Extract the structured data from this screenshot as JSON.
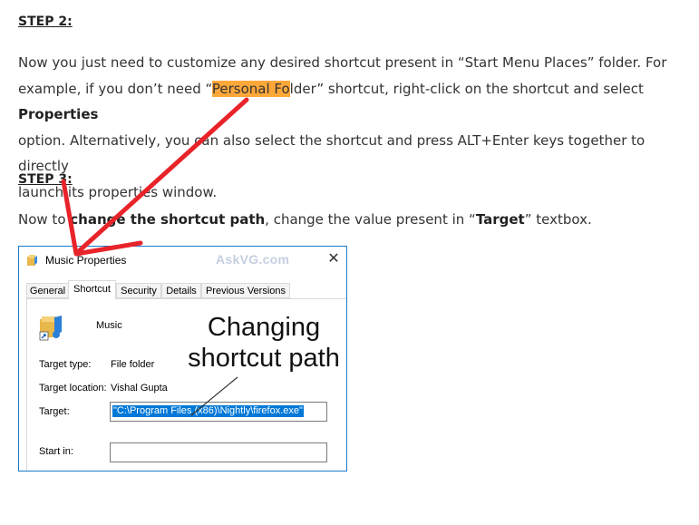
{
  "step2": {
    "heading": "STEP 2:",
    "line1": "Now you just need to customize any desired shortcut present in “Start Menu Places” folder. For",
    "line2_pre": "example, if you don’t need “",
    "line2_highlight": "Personal Fo",
    "line2_post": "lder” shortcut, right-click on the shortcut and select ",
    "line2_bold": "Properties",
    "line3": "option. Alternatively, you can also select the shortcut and press ALT+Enter keys together to directly",
    "line4": "launch its properties window."
  },
  "step3": {
    "heading": "STEP 3:",
    "line_pre": "Now to ",
    "line_bold1": "change the shortcut path",
    "line_mid": ", change the value present in “",
    "line_bold2": "Target",
    "line_post": "” textbox."
  },
  "dialog": {
    "title": "Music Properties",
    "watermark": "AskVG.com",
    "close": "✕",
    "tabs": [
      "General",
      "Shortcut",
      "Security",
      "Details",
      "Previous Versions"
    ],
    "active_tab": "Shortcut",
    "name": "Music",
    "target_type_label": "Target type:",
    "target_type_value": "File folder",
    "target_location_label": "Target location:",
    "target_location_value": "Vishal Gupta",
    "target_label": "Target:",
    "target_value": "\"C:\\Program Files (x86)\\Nightly\\firefox.exe\"",
    "start_in_label": "Start in:",
    "start_in_value": ""
  },
  "annotation": {
    "line1": "Changing",
    "line2": "shortcut path"
  },
  "colors": {
    "highlight": "#ffa83a",
    "arrow": "#e8232a",
    "dialog_border": "#1979ca",
    "selection": "#0078d7"
  },
  "icons": {
    "title_icon": "shortcut-folder-icon",
    "music_icon": "music-folder-icon",
    "arrow": "red-arrow"
  }
}
